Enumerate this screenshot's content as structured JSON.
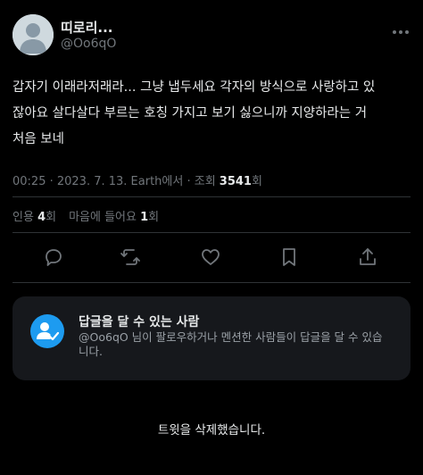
{
  "author": {
    "display_name": "띠로리...",
    "handle": "@Oo6qO"
  },
  "tweet": {
    "lines": [
      "갑자기 이래라저래라... 그냥 냅두세요 각자의 방식으로 사랑하고 있",
      "잖아요 살다살다 부르는 호칭 가지고 보기 싫으니까 지양하라는 거",
      "처음 보네"
    ],
    "meta_prefix": "00:25 · 2023. 7. 13. Earth에서 · 조회 ",
    "views": "3541",
    "views_suffix": "회"
  },
  "stats": {
    "quotes_label": "인용 ",
    "quotes_count": "4",
    "quotes_suffix": "회",
    "likes_label": "마음에 들어요 ",
    "likes_count": "1",
    "likes_suffix": "회"
  },
  "actions": [
    {
      "icon": "reply-icon"
    },
    {
      "icon": "retweet-icon"
    },
    {
      "icon": "like-icon"
    },
    {
      "icon": "bookmark-icon"
    },
    {
      "icon": "share-icon"
    }
  ],
  "reply_restriction": {
    "title": "답글을 달 수 있는 사람",
    "desc_lines": [
      "@Oo6qO 님이 팔로우하거나 멘션한 사람들이 답글을 달 수 있습",
      "니다."
    ],
    "icon": "user-check-icon"
  },
  "notice": {
    "text": "트윗을 삭제했습니다."
  },
  "colors": {
    "background": "#000000",
    "text": "#e7e9ea",
    "muted": "#71767b",
    "accent": "#1d9bf0",
    "card": "#16181c",
    "divider": "#2f3336"
  }
}
